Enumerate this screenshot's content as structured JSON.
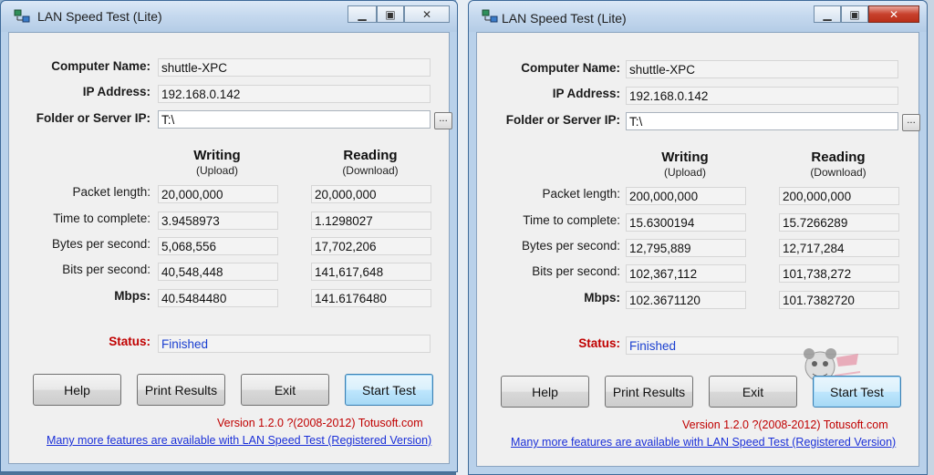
{
  "windows": [
    {
      "title": "LAN Speed Test (Lite)",
      "computer_name_label": "Computer Name:",
      "computer_name": "shuttle-XPC",
      "ip_label": "IP Address:",
      "ip": "192.168.0.142",
      "folder_label": "Folder or Server IP:",
      "folder": "T:\\",
      "browse_label": "...",
      "writing": "Writing",
      "upload": "(Upload)",
      "reading": "Reading",
      "download": "(Download)",
      "rows": [
        {
          "label": "Packet length:",
          "write": "20,000,000",
          "read": "20,000,000"
        },
        {
          "label": "Time to complete:",
          "write": "3.9458973",
          "read": "1.1298027"
        },
        {
          "label": "Bytes per second:",
          "write": "5,068,556",
          "read": "17,702,206"
        },
        {
          "label": "Bits per second:",
          "write": "40,548,448",
          "read": "141,617,648"
        },
        {
          "label": "Mbps:",
          "write": "40.5484480",
          "read": "141.6176480"
        }
      ],
      "status_label": "Status:",
      "status": "Finished",
      "buttons": {
        "help": "Help",
        "print": "Print Results",
        "exit": "Exit",
        "start": "Start Test"
      },
      "version": "Version 1.2.0  ?(2008-2012) Totusoft.com",
      "link": "Many more features are available with LAN Speed Test (Registered Version)"
    },
    {
      "title": "LAN Speed Test (Lite)",
      "computer_name_label": "Computer Name:",
      "computer_name": "shuttle-XPC",
      "ip_label": "IP Address:",
      "ip": "192.168.0.142",
      "folder_label": "Folder or Server IP:",
      "folder": "T:\\",
      "browse_label": "...",
      "writing": "Writing",
      "upload": "(Upload)",
      "reading": "Reading",
      "download": "(Download)",
      "rows": [
        {
          "label": "Packet length:",
          "write": "200,000,000",
          "read": "200,000,000"
        },
        {
          "label": "Time to complete:",
          "write": "15.6300194",
          "read": "15.7266289"
        },
        {
          "label": "Bytes per second:",
          "write": "12,795,889",
          "read": "12,717,284"
        },
        {
          "label": "Bits per second:",
          "write": "102,367,112",
          "read": "101,738,272"
        },
        {
          "label": "Mbps:",
          "write": "102.3671120",
          "read": "101.7382720"
        }
      ],
      "status_label": "Status:",
      "status": "Finished",
      "buttons": {
        "help": "Help",
        "print": "Print Results",
        "exit": "Exit",
        "start": "Start Test"
      },
      "version": "Version 1.2.0  ?(2008-2012) Totusoft.com",
      "link": "Many more features are available with LAN Speed Test (Registered Version)"
    }
  ],
  "icons": {
    "app": "network-computer-icon",
    "minimize": "minimize-icon",
    "maximize": "maximize-icon",
    "close": "close-icon",
    "watermark": "cartoon-mascot-watermark"
  },
  "colors": {
    "status_label": "#c00000",
    "status_value": "#1a3fd0",
    "version": "#c00000",
    "link": "#1a2fd8",
    "close_button_active": "#c8412d"
  }
}
